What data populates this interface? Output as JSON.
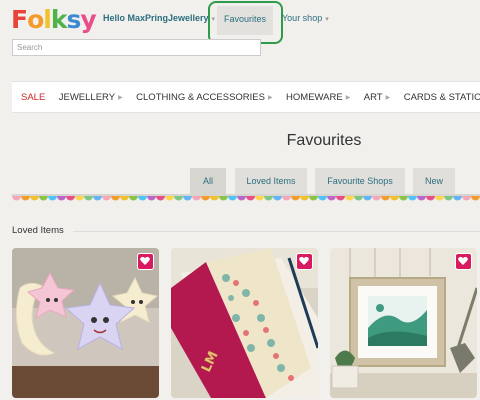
{
  "header": {
    "logo_letters": [
      "F",
      "o",
      "l",
      "k",
      "s",
      "y"
    ],
    "logo_colors": [
      "#e8443a",
      "#f39c2c",
      "#f1c22b",
      "#4fb34a",
      "#3b8bd0",
      "#e84e8a"
    ],
    "hello_text": "Hello MaxPringJewellery",
    "favourites_label": "Favourites",
    "your_shop_label": "Your shop",
    "search_placeholder": "Search"
  },
  "categories": [
    {
      "label": "SALE",
      "arrow": false,
      "sale": true
    },
    {
      "label": "JEWELLERY",
      "arrow": true
    },
    {
      "label": "CLOTHING & ACCESSORIES",
      "arrow": true
    },
    {
      "label": "HOMEWARE",
      "arrow": true
    },
    {
      "label": "ART",
      "arrow": true
    },
    {
      "label": "CARDS & STATIONERY",
      "arrow": true
    }
  ],
  "page": {
    "title": "Favourites",
    "tabs": [
      {
        "label": "All",
        "active": true
      },
      {
        "label": "Loved Items"
      },
      {
        "label": "Favourite Shops"
      },
      {
        "label": "New"
      }
    ],
    "section_title": "Loved Items"
  },
  "colors": {
    "accent": "#2c6e7e",
    "sale": "#c62a25",
    "heart": "#d81b60",
    "highlight": "#2e9a4c",
    "bunting": [
      "#f4a7b9",
      "#f39c2c",
      "#f1c22b",
      "#8bc34a",
      "#4fc3f7",
      "#ba68c8",
      "#e84e8a",
      "#ffd54f",
      "#81c784",
      "#64b5f6"
    ]
  },
  "items": [
    {
      "name": "star and moon plush toys"
    },
    {
      "name": "floral notebook with initials"
    },
    {
      "name": "framed green landscape print"
    }
  ]
}
